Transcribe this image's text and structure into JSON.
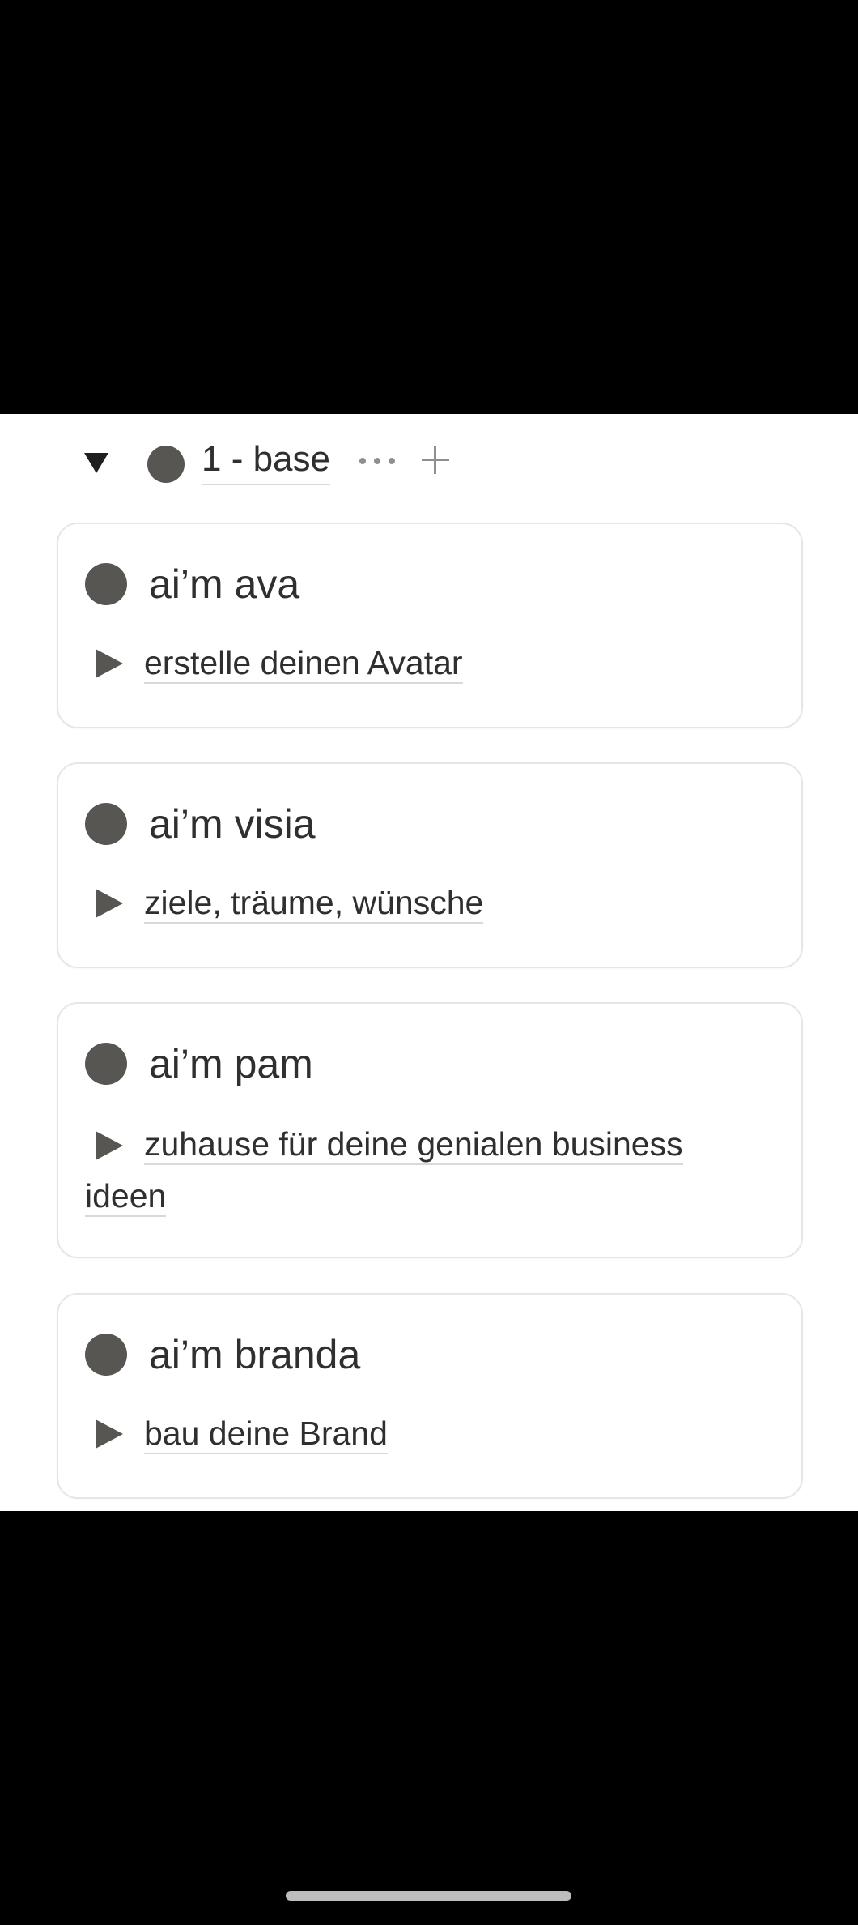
{
  "group": {
    "title": "1 - base",
    "more_icon": "more-horizontal-icon",
    "add_icon": "plus-icon",
    "toggle_icon": "caret-down-icon"
  },
  "cards": [
    {
      "title": "ai’m ava",
      "subtitle": "erstelle deinen Avatar"
    },
    {
      "title": "ai’m visia",
      "subtitle": "ziele, träume, wünsche"
    },
    {
      "title": "ai’m pam",
      "subtitle_line1": "zuhause für deine genialen business",
      "subtitle_line2": "ideen"
    },
    {
      "title": "ai’m branda",
      "subtitle": "bau deine Brand"
    }
  ],
  "colors": {
    "dot": "#575652",
    "text": "#2f2f2f",
    "card_border": "#e6e6e3",
    "muted_icon": "#8f8f8b"
  }
}
